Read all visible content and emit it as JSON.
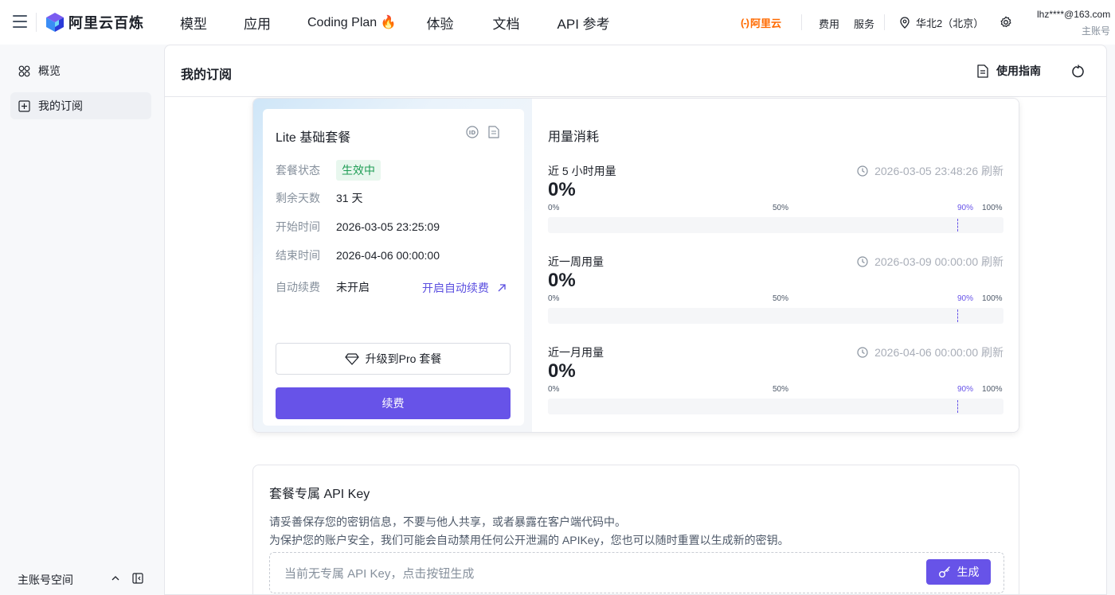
{
  "brand": {
    "name": "阿里云百炼"
  },
  "nav": {
    "items": [
      {
        "label": "模型"
      },
      {
        "label": "应用"
      },
      {
        "label": "Coding Plan 🔥"
      },
      {
        "label": "体验"
      },
      {
        "label": "文档"
      },
      {
        "label": "API 参考"
      }
    ]
  },
  "topright": {
    "aliyun_logo_text": "阿里云",
    "fee": "费用",
    "service": "服务",
    "region": "华北2（北京）",
    "user_email": "lhz****@163.com",
    "user_role": "主账号"
  },
  "sidebar": {
    "items": [
      {
        "label": "概览"
      },
      {
        "label": "我的订阅"
      }
    ],
    "workspace": "主账号空间"
  },
  "page": {
    "title": "我的订阅",
    "guide": "使用指南"
  },
  "plan": {
    "title": "Lite 基础套餐",
    "status_label": "套餐状态",
    "status_value": "生效中",
    "days_label": "剩余天数",
    "days_value": "31 天",
    "start_label": "开始时间",
    "start_value": "2026-03-05 23:25:09",
    "end_label": "结束时间",
    "end_value": "2026-04-06 00:00:00",
    "auto_label": "自动续费",
    "auto_value": "未开启",
    "auto_link": "开启自动续费",
    "upgrade_label": "升级到Pro 套餐",
    "renew_label": "续费"
  },
  "usage": {
    "title": "用量消耗",
    "ticks": [
      "0%",
      "50%",
      "90%",
      "100%"
    ],
    "blocks": [
      {
        "label": "近 5 小时用量",
        "refresh": "2026-03-05 23:48:26 刷新",
        "percent": "0%",
        "fill": 0
      },
      {
        "label": "近一周用量",
        "refresh": "2026-03-09 00:00:00 刷新",
        "percent": "0%",
        "fill": 0
      },
      {
        "label": "近一月用量",
        "refresh": "2026-04-06 00:00:00 刷新",
        "percent": "0%",
        "fill": 0
      }
    ]
  },
  "apikey": {
    "title": "套餐专属 API Key",
    "desc1": "请妥善保存您的密钥信息，不要与他人共享，或者暴露在客户端代码中。",
    "desc2": "为保护您的账户安全，我们可能会自动禁用任何公开泄漏的 APIKey，您也可以随时重置以生成新的密钥。",
    "placeholder": "当前无专属 API Key，点击按钮生成",
    "generate": "生成"
  },
  "colors": {
    "accent": "#6753e8",
    "aliyun_orange": "#ff6a00",
    "status_green": "#1f9d55"
  }
}
